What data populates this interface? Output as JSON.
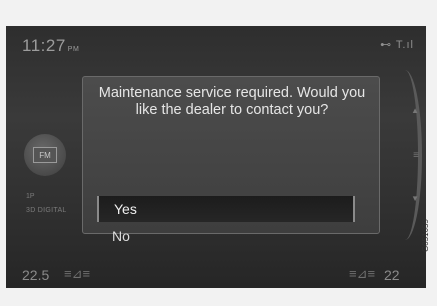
{
  "status": {
    "time": "11:27",
    "ampm": "PM",
    "signal_icons": "⊷ T.ıl"
  },
  "radio": {
    "band_label": "FM",
    "preset": "1P",
    "station": "3D DIGITAL"
  },
  "climate": {
    "left_temp": "22.5",
    "right_temp": "22",
    "left_seat_icon": "≡⊿≡",
    "right_seat_icon": "≡⊿≡"
  },
  "dialog": {
    "message": "Maintenance service required. Would you like the dealer to contact you?",
    "options": [
      "Yes",
      "No"
    ],
    "selected": "Yes"
  },
  "image_code": "G051059"
}
